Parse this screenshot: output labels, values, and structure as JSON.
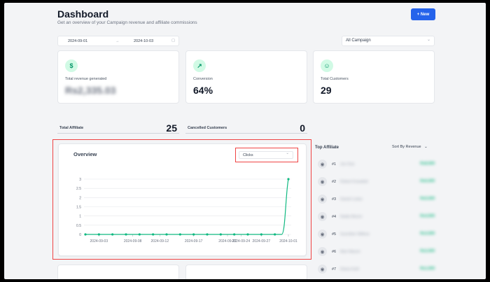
{
  "header": {
    "title": "Dashboard",
    "subtitle": "Get an overview of your Campaign revenue and affiliate commissions",
    "new_button": "+ New"
  },
  "filters": {
    "start_date": "2024-09-01",
    "arrow": "→",
    "end_date": "2024-10-03",
    "calendar_icon": "▢",
    "campaign": "All Campaign",
    "campaign_chevron": "⌄"
  },
  "stats": {
    "revenue": {
      "icon": "$",
      "label": "Total revenue generated",
      "value": "Rs2,335.03"
    },
    "conversion": {
      "icon": "↗",
      "label": "Conversion",
      "value": "64%"
    },
    "customers": {
      "icon": "☺",
      "label": "Total Customers",
      "value": "29"
    }
  },
  "counters": {
    "affiliate": {
      "label": "Total Affiliate",
      "value": "25"
    },
    "cancelled": {
      "label": "Cancelled Customers",
      "value": "0"
    }
  },
  "overview": {
    "title": "Overview",
    "metric": "Clicks",
    "chevron": "⌄"
  },
  "chart_data": {
    "type": "line",
    "x": [
      "2024-09-01",
      "2024-09-02",
      "2024-09-03",
      "2024-09-04",
      "2024-09-05",
      "2024-09-06",
      "2024-09-07",
      "2024-09-08",
      "2024-09-09",
      "2024-09-10",
      "2024-09-11",
      "2024-09-12",
      "2024-09-13",
      "2024-09-14",
      "2024-09-15",
      "2024-09-16",
      "2024-09-17",
      "2024-09-18",
      "2024-09-19",
      "2024-09-20",
      "2024-09-21",
      "2024-09-22",
      "2024-09-23",
      "2024-09-24",
      "2024-09-25",
      "2024-09-26",
      "2024-09-27",
      "2024-09-28",
      "2024-09-29",
      "2024-09-30",
      "2024-10-01"
    ],
    "values": [
      0,
      0,
      0,
      0,
      0,
      0,
      0,
      0,
      0,
      0,
      0,
      0,
      0,
      0,
      0,
      0,
      0,
      0,
      0,
      0,
      0,
      0,
      0,
      0,
      0,
      0,
      0,
      0,
      0,
      0,
      3
    ],
    "marker_every": 2,
    "x_tick_labels": [
      "2024-09-03",
      "2024-09-08",
      "2024-09-12",
      "2024-09-17",
      "2024-09-22",
      "2024-09-24",
      "2024-09-27",
      "2024-10-01"
    ],
    "x_tick_index": [
      2,
      7,
      11,
      16,
      21,
      23,
      26,
      30
    ],
    "y_ticks": [
      "0",
      "0.5",
      "1",
      "1.5",
      "2",
      "2.5",
      "3"
    ],
    "ylim": [
      0,
      3
    ],
    "grid": true,
    "line_color": "#10b981"
  },
  "top_affiliate": {
    "title": "Top Affiliate",
    "sort_label": "Sort By Revenue",
    "sort_chevron": "⌄",
    "avatar_icon": "◉",
    "items": [
      {
        "rank": "#1",
        "name": "Jon Doe",
        "amount": "Rs8,000"
      },
      {
        "rank": "#2",
        "name": "Robert Kowalski",
        "amount": "Rs6,000"
      },
      {
        "rank": "#3",
        "name": "Daniel Leduc",
        "amount": "Rs5,000"
      },
      {
        "rank": "#4",
        "name": "Nadia Munro",
        "amount": "Rs4,000"
      },
      {
        "rank": "#5",
        "name": "Guenther Wilkins",
        "amount": "Rs3,000"
      },
      {
        "rank": "#6",
        "name": "Mari Mason",
        "amount": "Rs2,000"
      },
      {
        "rank": "#7",
        "name": "Diana Kahl",
        "amount": "Rs1,000"
      }
    ]
  }
}
